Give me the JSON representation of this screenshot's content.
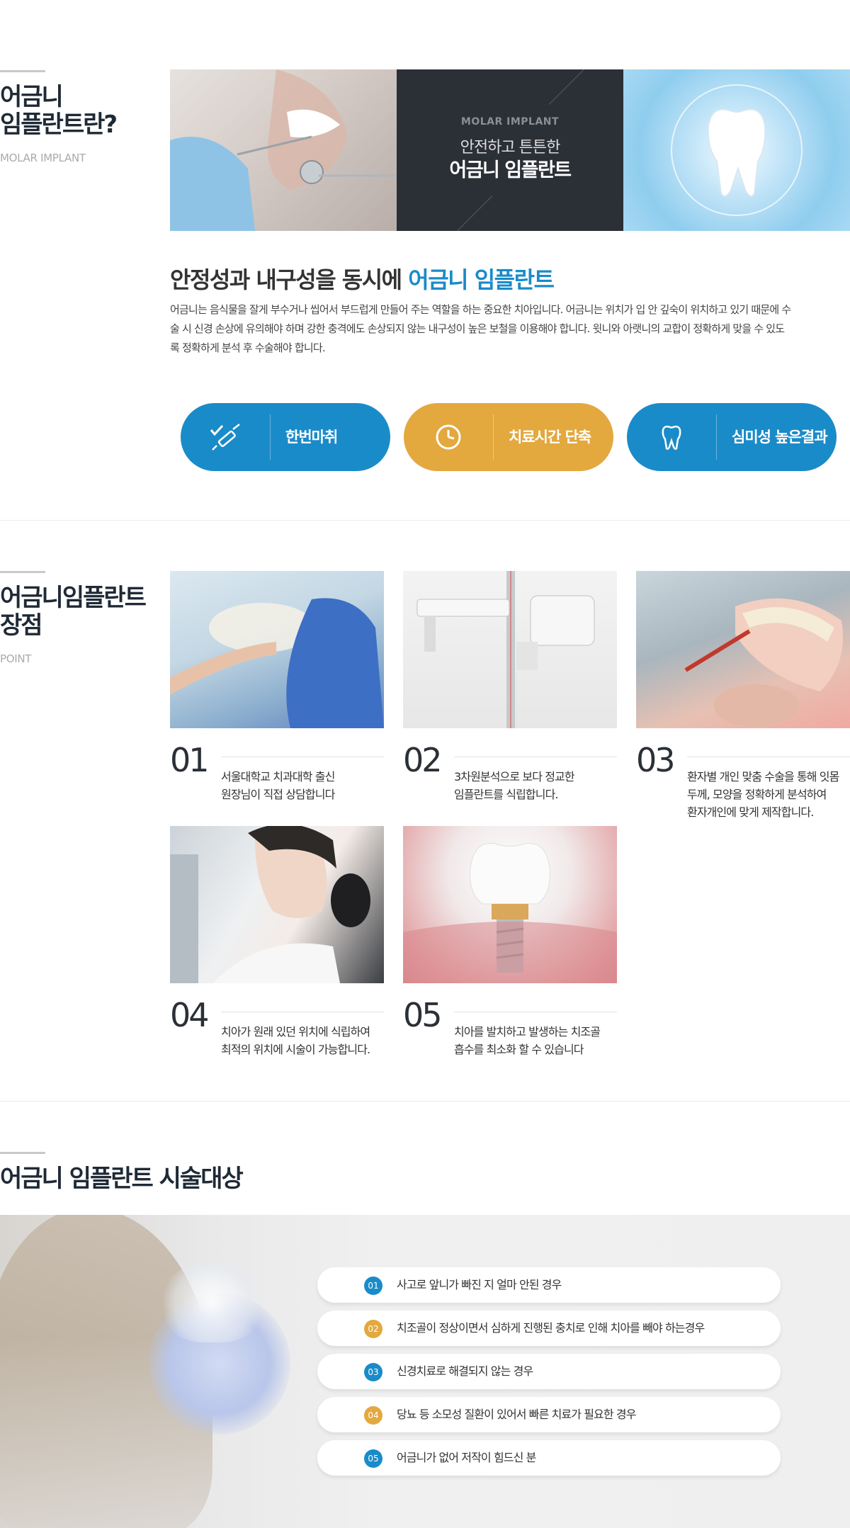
{
  "section1": {
    "title": "어금니\n임플란트란?",
    "subtitle": "MOLAR IMPLANT",
    "banner": {
      "en": "MOLAR IMPLANT",
      "line1": "안전하고 튼튼한",
      "line2": "어금니 임플란트"
    },
    "headline_main": "안정성과 내구성을 동시에 ",
    "headline_highlight": "어금니 임플란트",
    "description": "어금니는 음식물을 잘게 부수거나 씹어서 부드럽게 만들어 주는 역할을 하는 중요한 치아입니다. 어금니는 위치가 입 안 깊숙이 위치하고 있기 때문에 수술 시 신경 손상에 유의해야 하며 강한 충격에도 손상되지 않는 내구성이 높은 보철을 이용해야 합니다. 윗니와 아랫니의 교합이 정확하게 맞을 수 있도록 정확하게 분석 후 수술해야 합니다.",
    "features": [
      {
        "label": "한번마취",
        "icon": "syringe-icon",
        "color": "#1a8bc9"
      },
      {
        "label": "치료시간 단축",
        "icon": "clock-icon",
        "color": "#e3a83e"
      },
      {
        "label": "심미성 높은결과",
        "icon": "tooth-icon",
        "color": "#1a8bc9"
      }
    ]
  },
  "section2": {
    "title": "어금니임플란트\n장점",
    "subtitle": "POINT",
    "points": [
      {
        "num": "01",
        "text": "서울대학교 치과대학 출신\n원장님이 직접 상담합니다"
      },
      {
        "num": "02",
        "text": "3차원분석으로 보다 정교한\n임플란트를 식립합니다."
      },
      {
        "num": "03",
        "text": "환자별 개인 맞춤 수술을 통해 잇몸\n두께, 모양을 정확하게 분석하여\n환자개인에 맞게 제작합니다."
      },
      {
        "num": "04",
        "text": "치아가 원래 있던 위치에 식립하여\n최적의 위치에 시술이 가능합니다."
      },
      {
        "num": "05",
        "text": "치아를 발치하고 발생하는 치조골\n흡수를 최소화 할 수 있습니다"
      }
    ]
  },
  "section3": {
    "title": "어금니 임플란트 시술대상",
    "items": [
      {
        "num": "01",
        "text": "사고로 앞니가 빠진 지 얼마 안된 경우",
        "color": "blue"
      },
      {
        "num": "02",
        "text": "치조골이 정상이면서 심하게 진행된 충치로 인해 치아를 빼야 하는경우",
        "color": "gold"
      },
      {
        "num": "03",
        "text": "신경치료로 해결되지 않는 경우",
        "color": "blue"
      },
      {
        "num": "04",
        "text": "당뇨 등 소모성 질환이 있어서 빠른 치료가 필요한 경우",
        "color": "gold"
      },
      {
        "num": "05",
        "text": "어금니가 없어 저작이 힘드신 분",
        "color": "blue"
      }
    ]
  }
}
